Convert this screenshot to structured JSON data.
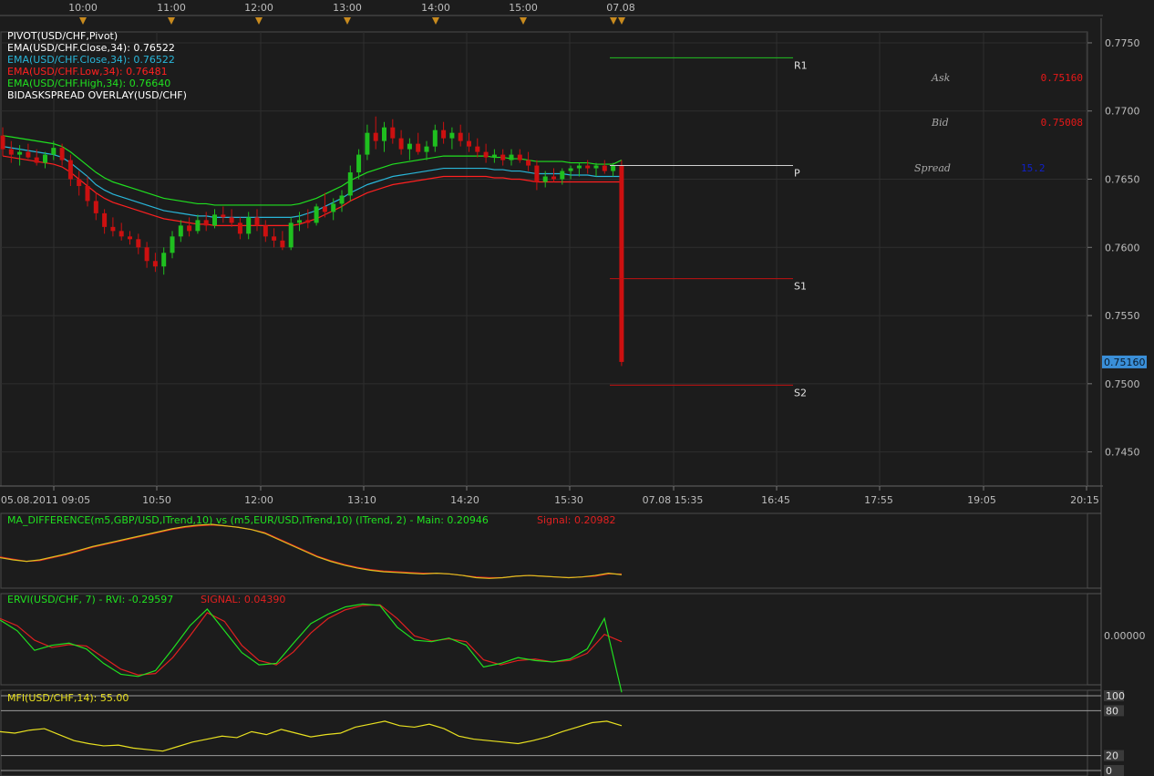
{
  "colors": {
    "background": "#1c1c1c",
    "panel_border": "#4a4a4a",
    "grid": "#2e2e2e",
    "axis_text": "#bdbdbd",
    "ema_close_1": "#ffffff",
    "ema_close": "#29b6d9",
    "ema_low": "#ff2020",
    "ema_high": "#20e020",
    "bull": "#1fbf1f",
    "bear": "#cc1010",
    "pivot_p": "#d0d0d0",
    "pivot_r1": "#20c020",
    "pivot_s": "#c01010",
    "mfi": "#e8e020",
    "current_price_tag": "#3a8fd8",
    "event_marker": "#c88a1e"
  },
  "top_time_axis": {
    "labels": [
      "10:00",
      "11:00",
      "12:00",
      "13:00",
      "14:00",
      "15:00",
      "07.08"
    ]
  },
  "legend": {
    "line1": "PIVOT(USD/CHF,Pivot)",
    "line2": "EMA(USD/CHF.Close,34): 0.76522",
    "line3": "EMA(USD/CHF.Close,34): 0.76522",
    "line4": "EMA(USD/CHF.Low,34): 0.76481",
    "line5": "EMA(USD/CHF.High,34): 0.76640",
    "line6": "BIDASKSPREAD OVERLAY(USD/CHF)"
  },
  "quote_panel": {
    "ask_label": "Ask",
    "ask_value": "0.75160",
    "bid_label": "Bid",
    "bid_value": "0.75008",
    "spread_label": "Spread",
    "spread_value": "15.2"
  },
  "pivot_labels": {
    "r1": "R1",
    "p": "P",
    "s1": "S1",
    "s2": "S2"
  },
  "current_price_tag": "0.75160",
  "bottom_time_axis": {
    "labels": [
      "05.08.2011 09:05",
      "10:50",
      "12:00",
      "13:10",
      "14:20",
      "15:30",
      "07.08 15:35",
      "16:45",
      "17:55",
      "19:05",
      "20:15"
    ]
  },
  "indicators": {
    "ma_diff": {
      "title": "MA_DIFFERENCE(m5,GBP/USD,ITrend,10) vs (m5,EUR/USD,ITrend,10) (ITrend, 2) -  Main: 0.20946",
      "signal": "Signal: 0.20982"
    },
    "ervi": {
      "title": "ERVI(USD/CHF, 7) -  RVI: -0.29597",
      "signal": "SIGNAL: 0.04390",
      "zero_label": "0.00000"
    },
    "mfi": {
      "title": "MFI(USD/CHF,14): 55.00",
      "levels": [
        "100",
        "80",
        "20",
        "0"
      ]
    }
  },
  "chart_data": {
    "type": "candlestick",
    "symbol": "USD/CHF",
    "y_ticks": [
      "0.7750",
      "0.7700",
      "0.7650",
      "0.7600",
      "0.7550",
      "0.7500",
      "0.7450"
    ],
    "ylim": [
      0.7425,
      0.7758
    ],
    "candles_ohlc": [
      [
        0.7682,
        0.7688,
        0.7667,
        0.7672
      ],
      [
        0.7672,
        0.7678,
        0.7662,
        0.7668
      ],
      [
        0.7668,
        0.7675,
        0.766,
        0.767
      ],
      [
        0.767,
        0.7676,
        0.7665,
        0.7666
      ],
      [
        0.7666,
        0.7672,
        0.766,
        0.7662
      ],
      [
        0.7662,
        0.767,
        0.7658,
        0.7668
      ],
      [
        0.7668,
        0.7678,
        0.7664,
        0.7673
      ],
      [
        0.7673,
        0.7676,
        0.766,
        0.7664
      ],
      [
        0.7664,
        0.7668,
        0.7645,
        0.765
      ],
      [
        0.765,
        0.7656,
        0.7638,
        0.7645
      ],
      [
        0.7645,
        0.7652,
        0.763,
        0.7634
      ],
      [
        0.7634,
        0.764,
        0.762,
        0.7625
      ],
      [
        0.7625,
        0.7628,
        0.761,
        0.7615
      ],
      [
        0.7615,
        0.7622,
        0.7608,
        0.7612
      ],
      [
        0.7612,
        0.7618,
        0.7605,
        0.7608
      ],
      [
        0.7608,
        0.7612,
        0.7602,
        0.7606
      ],
      [
        0.7606,
        0.761,
        0.7595,
        0.76
      ],
      [
        0.76,
        0.7604,
        0.7585,
        0.759
      ],
      [
        0.759,
        0.7596,
        0.7582,
        0.7586
      ],
      [
        0.7586,
        0.76,
        0.758,
        0.7596
      ],
      [
        0.7596,
        0.7612,
        0.7592,
        0.7608
      ],
      [
        0.7608,
        0.762,
        0.7604,
        0.7616
      ],
      [
        0.7616,
        0.7622,
        0.7608,
        0.7612
      ],
      [
        0.7612,
        0.7624,
        0.761,
        0.762
      ],
      [
        0.762,
        0.7626,
        0.7612,
        0.7616
      ],
      [
        0.7616,
        0.7628,
        0.7614,
        0.7624
      ],
      [
        0.7624,
        0.763,
        0.7618,
        0.7622
      ],
      [
        0.7622,
        0.7628,
        0.7615,
        0.7618
      ],
      [
        0.7618,
        0.7622,
        0.7606,
        0.761
      ],
      [
        0.761,
        0.7626,
        0.7606,
        0.7622
      ],
      [
        0.7622,
        0.7628,
        0.7612,
        0.7616
      ],
      [
        0.7616,
        0.762,
        0.7604,
        0.7608
      ],
      [
        0.7608,
        0.7614,
        0.76,
        0.7605
      ],
      [
        0.7605,
        0.7612,
        0.7598,
        0.76
      ],
      [
        0.76,
        0.7622,
        0.7598,
        0.7618
      ],
      [
        0.7618,
        0.7626,
        0.7612,
        0.762
      ],
      [
        0.762,
        0.7628,
        0.7614,
        0.7618
      ],
      [
        0.7618,
        0.7632,
        0.7616,
        0.763
      ],
      [
        0.763,
        0.764,
        0.7622,
        0.7626
      ],
      [
        0.7626,
        0.7636,
        0.762,
        0.7632
      ],
      [
        0.7632,
        0.7642,
        0.7626,
        0.7638
      ],
      [
        0.7638,
        0.766,
        0.7634,
        0.7655
      ],
      [
        0.7655,
        0.7672,
        0.765,
        0.7668
      ],
      [
        0.7668,
        0.769,
        0.7664,
        0.7684
      ],
      [
        0.7684,
        0.7696,
        0.7672,
        0.7678
      ],
      [
        0.7678,
        0.7692,
        0.767,
        0.7688
      ],
      [
        0.7688,
        0.7694,
        0.7676,
        0.768
      ],
      [
        0.768,
        0.7686,
        0.7668,
        0.7672
      ],
      [
        0.7672,
        0.768,
        0.7664,
        0.7676
      ],
      [
        0.7676,
        0.7684,
        0.7668,
        0.767
      ],
      [
        0.767,
        0.7678,
        0.7664,
        0.7674
      ],
      [
        0.7674,
        0.769,
        0.767,
        0.7686
      ],
      [
        0.7686,
        0.7692,
        0.7676,
        0.768
      ],
      [
        0.768,
        0.7688,
        0.7672,
        0.7684
      ],
      [
        0.7684,
        0.769,
        0.7674,
        0.7678
      ],
      [
        0.7678,
        0.7684,
        0.767,
        0.7674
      ],
      [
        0.7674,
        0.768,
        0.7666,
        0.767
      ],
      [
        0.767,
        0.7676,
        0.7662,
        0.7666
      ],
      [
        0.7666,
        0.7672,
        0.7662,
        0.7668
      ],
      [
        0.7668,
        0.7672,
        0.766,
        0.7664
      ],
      [
        0.7664,
        0.7672,
        0.766,
        0.7668
      ],
      [
        0.7668,
        0.7672,
        0.7662,
        0.7664
      ],
      [
        0.7664,
        0.767,
        0.7656,
        0.766
      ],
      [
        0.766,
        0.7664,
        0.7642,
        0.7648
      ],
      [
        0.7648,
        0.7656,
        0.7644,
        0.7652
      ],
      [
        0.7652,
        0.7658,
        0.7648,
        0.765
      ],
      [
        0.765,
        0.7658,
        0.7646,
        0.7656
      ],
      [
        0.7656,
        0.766,
        0.765,
        0.7658
      ],
      [
        0.7658,
        0.7662,
        0.7652,
        0.766
      ],
      [
        0.766,
        0.7664,
        0.7654,
        0.7658
      ],
      [
        0.7658,
        0.7662,
        0.7652,
        0.766
      ],
      [
        0.766,
        0.7664,
        0.7654,
        0.7656
      ],
      [
        0.7656,
        0.7662,
        0.7652,
        0.766
      ],
      [
        0.766,
        0.7664,
        0.7513,
        0.7516
      ]
    ],
    "ema_close": [
      0.7674,
      0.7673,
      0.7672,
      0.7671,
      0.767,
      0.7669,
      0.7668,
      0.7666,
      0.7662,
      0.7657,
      0.7652,
      0.7646,
      0.7642,
      0.7639,
      0.7637,
      0.7635,
      0.7633,
      0.7631,
      0.7629,
      0.7627,
      0.7626,
      0.7625,
      0.7624,
      0.7623,
      0.7623,
      0.7622,
      0.7622,
      0.7622,
      0.7622,
      0.7622,
      0.7622,
      0.7622,
      0.7622,
      0.7622,
      0.7622,
      0.7623,
      0.7625,
      0.7627,
      0.763,
      0.7633,
      0.7636,
      0.764,
      0.7643,
      0.7646,
      0.7648,
      0.765,
      0.7652,
      0.7653,
      0.7654,
      0.7655,
      0.7656,
      0.7657,
      0.7658,
      0.7658,
      0.7658,
      0.7658,
      0.7658,
      0.7658,
      0.7657,
      0.7657,
      0.7656,
      0.7656,
      0.7655,
      0.7654,
      0.7654,
      0.7654,
      0.7654,
      0.7653,
      0.7653,
      0.7653,
      0.7652,
      0.7652,
      0.7652,
      0.7652
    ],
    "ema_low": [
      0.7667,
      0.7666,
      0.7665,
      0.7664,
      0.7663,
      0.7662,
      0.7661,
      0.7659,
      0.7655,
      0.765,
      0.7645,
      0.764,
      0.7636,
      0.7633,
      0.7631,
      0.7629,
      0.7627,
      0.7625,
      0.7623,
      0.7621,
      0.762,
      0.7619,
      0.7618,
      0.7617,
      0.7617,
      0.7616,
      0.7616,
      0.7616,
      0.7616,
      0.7616,
      0.7616,
      0.7616,
      0.7616,
      0.7616,
      0.7616,
      0.7617,
      0.7619,
      0.7621,
      0.7624,
      0.7627,
      0.763,
      0.7634,
      0.7637,
      0.764,
      0.7642,
      0.7644,
      0.7646,
      0.7647,
      0.7648,
      0.7649,
      0.765,
      0.7651,
      0.7652,
      0.7652,
      0.7652,
      0.7652,
      0.7652,
      0.7652,
      0.7651,
      0.7651,
      0.765,
      0.765,
      0.7649,
      0.7648,
      0.7648,
      0.7648,
      0.7648,
      0.7648,
      0.7648,
      0.7648,
      0.7648,
      0.7648,
      0.7648,
      0.7648
    ],
    "ema_high": [
      0.7682,
      0.7681,
      0.768,
      0.7679,
      0.7678,
      0.7677,
      0.7676,
      0.7674,
      0.767,
      0.7665,
      0.766,
      0.7655,
      0.7651,
      0.7648,
      0.7646,
      0.7644,
      0.7642,
      0.764,
      0.7638,
      0.7636,
      0.7635,
      0.7634,
      0.7633,
      0.7632,
      0.7632,
      0.7631,
      0.7631,
      0.7631,
      0.7631,
      0.7631,
      0.7631,
      0.7631,
      0.7631,
      0.7631,
      0.7631,
      0.7632,
      0.7634,
      0.7636,
      0.7639,
      0.7642,
      0.7645,
      0.7649,
      0.7652,
      0.7655,
      0.7657,
      0.7659,
      0.7661,
      0.7662,
      0.7663,
      0.7664,
      0.7665,
      0.7666,
      0.7667,
      0.7667,
      0.7667,
      0.7667,
      0.7667,
      0.7667,
      0.7666,
      0.7666,
      0.7665,
      0.7665,
      0.7664,
      0.7663,
      0.7663,
      0.7663,
      0.7663,
      0.7662,
      0.7662,
      0.7662,
      0.7661,
      0.7661,
      0.7661,
      0.7664
    ],
    "pivots": {
      "r1": 0.7739,
      "p": 0.766,
      "s1": 0.7577,
      "s2": 0.7499
    },
    "ma_diff_main": [
      0.55,
      0.52,
      0.5,
      0.52,
      0.56,
      0.6,
      0.65,
      0.7,
      0.74,
      0.78,
      0.82,
      0.86,
      0.9,
      0.94,
      0.97,
      0.99,
      1.0,
      0.98,
      0.96,
      0.93,
      0.88,
      0.8,
      0.72,
      0.64,
      0.56,
      0.5,
      0.45,
      0.41,
      0.38,
      0.36,
      0.35,
      0.34,
      0.33,
      0.34,
      0.33,
      0.31,
      0.28,
      0.27,
      0.28,
      0.3,
      0.31,
      0.3,
      0.29,
      0.28,
      0.29,
      0.31,
      0.34,
      0.32
    ],
    "ma_diff_signal": [
      0.56,
      0.53,
      0.5,
      0.51,
      0.55,
      0.59,
      0.64,
      0.69,
      0.73,
      0.77,
      0.81,
      0.85,
      0.89,
      0.93,
      0.96,
      0.98,
      0.99,
      0.98,
      0.96,
      0.93,
      0.89,
      0.81,
      0.73,
      0.65,
      0.57,
      0.51,
      0.46,
      0.42,
      0.39,
      0.37,
      0.36,
      0.35,
      0.34,
      0.34,
      0.33,
      0.31,
      0.29,
      0.28,
      0.28,
      0.3,
      0.31,
      0.3,
      0.29,
      0.28,
      0.29,
      0.3,
      0.33,
      0.33
    ],
    "ervi_rvi": [
      0.7,
      0.55,
      0.28,
      0.35,
      0.38,
      0.3,
      0.1,
      -0.05,
      -0.08,
      0.0,
      0.3,
      0.62,
      0.85,
      0.55,
      0.25,
      0.08,
      0.1,
      0.38,
      0.65,
      0.78,
      0.88,
      0.92,
      0.9,
      0.6,
      0.42,
      0.4,
      0.45,
      0.35,
      0.05,
      0.1,
      0.18,
      0.14,
      0.12,
      0.16,
      0.3,
      0.72,
      -0.3
    ],
    "ervi_signal": [
      0.72,
      0.62,
      0.42,
      0.32,
      0.36,
      0.34,
      0.18,
      0.02,
      -0.06,
      -0.04,
      0.18,
      0.48,
      0.8,
      0.68,
      0.35,
      0.14,
      0.08,
      0.26,
      0.52,
      0.72,
      0.84,
      0.9,
      0.91,
      0.72,
      0.48,
      0.41,
      0.44,
      0.4,
      0.15,
      0.08,
      0.14,
      0.16,
      0.12,
      0.14,
      0.24,
      0.5,
      0.4
    ],
    "mfi": [
      52,
      50,
      54,
      56,
      48,
      40,
      36,
      33,
      34,
      30,
      28,
      26,
      32,
      38,
      42,
      46,
      44,
      52,
      48,
      55,
      50,
      45,
      48,
      50,
      58,
      62,
      66,
      60,
      58,
      62,
      56,
      46,
      42,
      40,
      38,
      36,
      40,
      45,
      52,
      58,
      64,
      66,
      60
    ]
  }
}
